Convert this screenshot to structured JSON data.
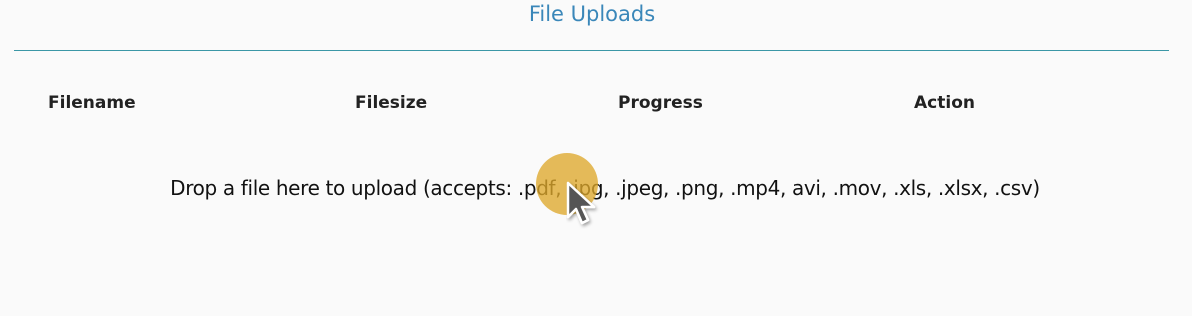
{
  "header": {
    "title": "File Uploads"
  },
  "table": {
    "columns": [
      "Filename",
      "Filesize",
      "Progress",
      "Action"
    ]
  },
  "dropzone": {
    "text": "Drop a file here to upload (accepts: .pdf, .jpg, .jpeg, .png, .mp4, avi, .mov, .xls, .xlsx, .csv)"
  },
  "colors": {
    "title": "#3a87b9",
    "divider": "#3b97a6",
    "click_highlight": "#dea82b"
  },
  "icons": {
    "cursor": "mouse-pointer-icon"
  }
}
